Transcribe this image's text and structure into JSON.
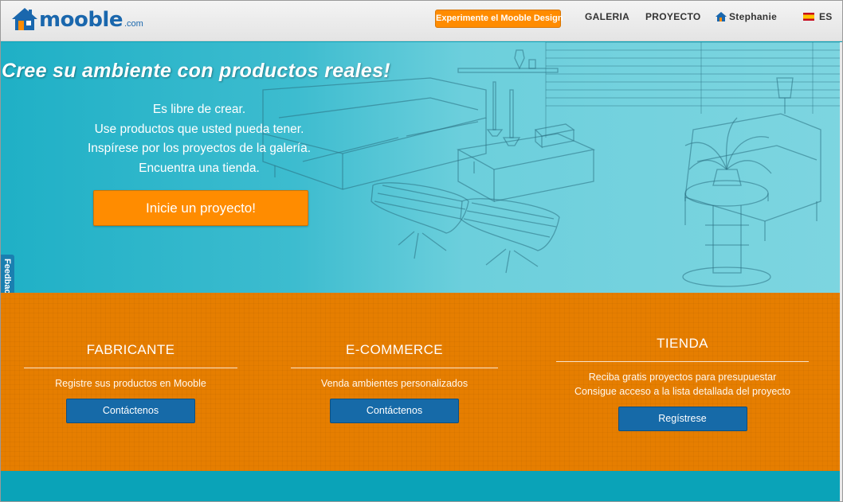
{
  "header": {
    "logo_text": "mooble",
    "logo_tld": ".com",
    "cta_label": "Experimente el Mooble Design",
    "nav_galeria": "GALERIA",
    "nav_proyecto": "PROYECTO",
    "user_name": "Stephanie",
    "lang_label": "ES"
  },
  "hero": {
    "title": "Cree su ambiente con productos reales!",
    "lines": [
      "Es libre de crear.",
      "Use productos que usted pueda tener.",
      "Inspírese por los proyectos de la galería.",
      "Encuentra una tienda."
    ],
    "cta_label": "Inicie un proyecto!"
  },
  "feedback_label": "Feedback",
  "columns": [
    {
      "title": "FABRICANTE",
      "desc": [
        "Registre sus productos en Mooble"
      ],
      "button": "Contáctenos"
    },
    {
      "title": "E-COMMERCE",
      "desc": [
        "Venda ambientes personalizados"
      ],
      "button": "Contáctenos"
    },
    {
      "title": "TIENDA",
      "desc": [
        "Reciba gratis proyectos para presupuestar",
        "Consigue acceso a la lista detallada del proyecto"
      ],
      "button": "Regístrese"
    }
  ],
  "colors": {
    "brand_blue": "#1a67ad",
    "accent_orange": "#ff8c00",
    "band_orange": "#e67e00",
    "teal": "#0aa3b8"
  },
  "icons": {
    "logo": "house-icon",
    "user": "house-icon",
    "lang": "spain-flag-icon"
  }
}
